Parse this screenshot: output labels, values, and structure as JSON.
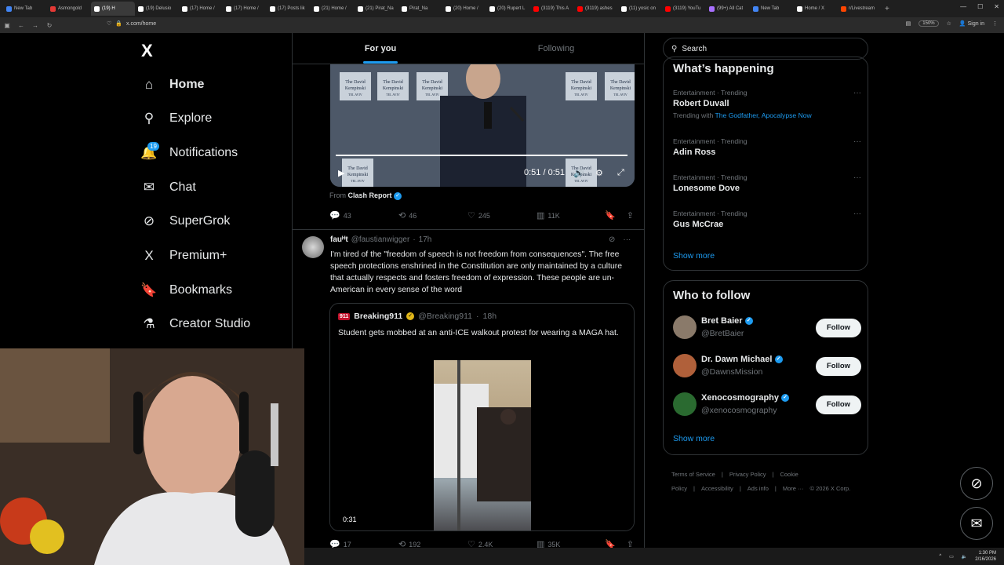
{
  "browser": {
    "tabs": [
      {
        "label": "New Tab",
        "color": "#4285f4"
      },
      {
        "label": "Asmongold",
        "color": "#e53935"
      },
      {
        "label": "(19) H",
        "color": "#ffffff",
        "active": true
      },
      {
        "label": "(19) Delusio",
        "color": "#ffffff"
      },
      {
        "label": "(17) Home /",
        "color": "#ffffff"
      },
      {
        "label": "(17) Home /",
        "color": "#ffffff"
      },
      {
        "label": "(17) Posts lik",
        "color": "#ffffff"
      },
      {
        "label": "(21) Home /",
        "color": "#ffffff"
      },
      {
        "label": "(21) Pirat_Na",
        "color": "#ffffff"
      },
      {
        "label": "Pirat_Na",
        "color": "#ffffff"
      },
      {
        "label": "(20) Home /",
        "color": "#ffffff"
      },
      {
        "label": "(20) Rupert L",
        "color": "#ffffff"
      },
      {
        "label": "(3119) This A",
        "color": "#ff0000"
      },
      {
        "label": "(3119) ashes",
        "color": "#ff0000"
      },
      {
        "label": "(11) yosic on",
        "color": "#ffffff"
      },
      {
        "label": "(3119) YouTu",
        "color": "#ff0000"
      },
      {
        "label": "(99+) All Cat",
        "color": "#a970ff"
      },
      {
        "label": "New Tab",
        "color": "#4285f4"
      },
      {
        "label": "Home / X",
        "color": "#ffffff"
      },
      {
        "label": "r/Livestream",
        "color": "#ff4500"
      }
    ],
    "url": "x.com/home",
    "zoom": "150%",
    "sign_in": "Sign in"
  },
  "nav": {
    "logo": "X",
    "items": [
      {
        "label": "Home",
        "icon": "home-icon",
        "glyph": "⌂"
      },
      {
        "label": "Explore",
        "icon": "search-icon",
        "glyph": "⚲"
      },
      {
        "label": "Notifications",
        "icon": "bell-icon",
        "glyph": "🔔",
        "badge": "19"
      },
      {
        "label": "Chat",
        "icon": "mail-icon",
        "glyph": "✉"
      },
      {
        "label": "SuperGrok",
        "icon": "grok-icon",
        "glyph": "⊘"
      },
      {
        "label": "Premium+",
        "icon": "x-icon",
        "glyph": "X"
      },
      {
        "label": "Bookmarks",
        "icon": "bookmark-icon",
        "glyph": "🔖"
      },
      {
        "label": "Creator Studio",
        "icon": "flask-icon",
        "glyph": "⚗"
      }
    ]
  },
  "feed": {
    "tabs": [
      "For you",
      "Following"
    ],
    "video_post": {
      "banner_lines": [
        "The David",
        "Kempinski",
        "TEL AVIV"
      ],
      "time": "0:51 / 0:51",
      "from_label": "From",
      "from_name": "Clash Report",
      "replies": "43",
      "reposts": "46",
      "likes": "245",
      "views": "11K"
    },
    "post2": {
      "author": "fauᴴt",
      "handle": "@faustianwigger",
      "age": "17h",
      "text": "I'm tired of the \"freedom of speech is not freedom from consequences\". The free speech protections enshrined in the Constitution are only maintained by a culture that actually respects and fosters freedom of expression. These people are un-American in every sense of the word",
      "quote": {
        "logo": "911",
        "name": "Breaking911",
        "handle": "@Breaking911",
        "age": "18h",
        "text": "Student gets mobbed at an anti-ICE walkout protest for wearing a MAGA hat.",
        "duration": "0:31"
      },
      "replies": "17",
      "reposts": "192",
      "likes": "2.4K",
      "views": "35K"
    }
  },
  "right": {
    "search_placeholder": "Search",
    "trending_title": "What’s happening",
    "trends": [
      {
        "meta": "Entertainment · Trending",
        "name": "Robert Duvall",
        "sub_prefix": "Trending with",
        "sub_links": "The Godfather, Apocalypse Now"
      },
      {
        "meta": "Entertainment · Trending",
        "name": "Adin Ross"
      },
      {
        "meta": "Entertainment · Trending",
        "name": "Lonesome Dove"
      },
      {
        "meta": "Entertainment · Trending",
        "name": "Gus McCrae"
      }
    ],
    "show_more": "Show more",
    "wtf_title": "Who to follow",
    "follows": [
      {
        "name": "Bret Baier",
        "handle": "@BretBaier",
        "avatar_color": "#8a7a6a"
      },
      {
        "name": "Dr. Dawn Michael",
        "handle": "@DawnsMission",
        "avatar_color": "#b0603a"
      },
      {
        "name": "Xenocosmography",
        "handle": "@xenocosmography",
        "avatar_color": "#2a6a30"
      }
    ],
    "follow_label": "Follow",
    "footer": [
      "Terms of Service",
      "|",
      "Privacy Policy",
      "|",
      "Cookie Policy",
      "|",
      "Accessibility",
      "|",
      "Ads info",
      "|",
      "More ···",
      "© 2026 X Corp."
    ]
  },
  "taskbar": {
    "time": "1:30 PM",
    "date": "2/16/2026"
  }
}
